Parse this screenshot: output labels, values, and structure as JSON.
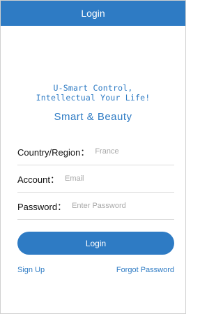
{
  "header": {
    "title": "Login"
  },
  "branding": {
    "tagline_line1": "U-Smart Control,",
    "tagline_line2": "Intellectual Your Life!",
    "subtitle": "Smart & Beauty"
  },
  "form": {
    "country": {
      "label": "Country/Region：",
      "placeholder": "France"
    },
    "account": {
      "label": "Account：",
      "placeholder": "Email"
    },
    "password": {
      "label": "Password：",
      "placeholder": "Enter Password"
    }
  },
  "actions": {
    "login_label": "Login",
    "signup_label": "Sign Up",
    "forgot_label": "Forgot Password"
  },
  "colors": {
    "accent": "#2e7bc4"
  }
}
